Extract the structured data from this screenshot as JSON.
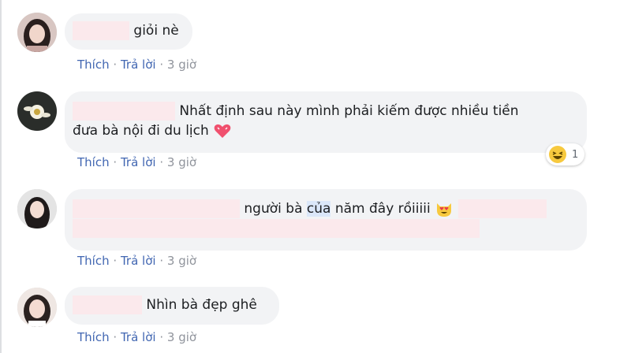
{
  "comments": [
    {
      "text": "giỏi nè",
      "actions": {
        "like": "Thích",
        "reply": "Trả lời",
        "time": "3 giờ"
      }
    },
    {
      "line1": "Nhất định sau này mình phải kiếm được nhiều tiền",
      "line2": "đưa bà nội đi du lịch",
      "emoji": "heart-emoji",
      "actions": {
        "like": "Thích",
        "reply": "Trả lời",
        "time": "3 giờ"
      },
      "reaction": {
        "icon": "laughing-emoji",
        "count": "1"
      }
    },
    {
      "text_part1": "người bà ",
      "text_highlight": "của",
      "text_part2": " năm đây rồiiiii",
      "emoji": "heart-eyes-cat-emoji",
      "actions": {
        "like": "Thích",
        "reply": "Trả lời",
        "time": "3 giờ"
      }
    },
    {
      "text": "Nhìn bà đẹp ghê",
      "actions": {
        "like": "Thích",
        "reply": "Trả lời",
        "time": "3 giờ"
      }
    }
  ],
  "separator": "·",
  "colors": {
    "bubble": "#f2f3f5",
    "link": "#4267b2",
    "muted": "#90949c",
    "redaction": "#fbe9ec"
  }
}
